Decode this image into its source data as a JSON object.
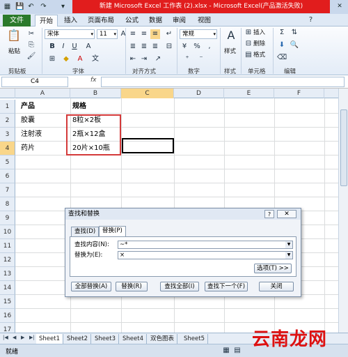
{
  "window": {
    "title": "新建 Microsoft Excel 工作表 (2).xlsx - Microsoft Excel(产品激活失败)",
    "controls": [
      "—",
      "□",
      "✕"
    ]
  },
  "ribbon": {
    "file_tab": "文件",
    "tabs": [
      "开始",
      "插入",
      "页面布局",
      "公式",
      "数据",
      "审阅",
      "视图"
    ],
    "groups": {
      "clipboard": {
        "label": "剪贴板",
        "paste": "粘贴"
      },
      "font": {
        "label": "字体",
        "font_name": "宋体",
        "font_size": "11"
      },
      "alignment": {
        "label": "对齐方式"
      },
      "number": {
        "label": "数字",
        "format": "常规"
      },
      "styles": {
        "label": "样式",
        "button": "样式"
      },
      "cells": {
        "label": "单元格",
        "insert": "插入",
        "delete": "删除",
        "format": "格式"
      },
      "editing": {
        "label": "编辑"
      }
    }
  },
  "formula_bar": {
    "name_box": "C4",
    "fx": "fx",
    "content": ""
  },
  "grid": {
    "columns": [
      "A",
      "B",
      "C",
      "D",
      "E",
      "F"
    ],
    "rows": [
      "1",
      "2",
      "3",
      "4",
      "5",
      "6",
      "7",
      "8",
      "9",
      "10",
      "11",
      "12",
      "13",
      "14",
      "15",
      "16",
      "17"
    ],
    "selected_column": "C",
    "selected_row": "4",
    "cells": {
      "A1": "产品",
      "B1": "规格",
      "A2": "胶囊",
      "B2": "8粒×2板",
      "A3": "注射液",
      "B3": "2瓶×12盒",
      "A4": "药片",
      "B4": "20片×10瓶"
    }
  },
  "sheets": [
    "Sheet1",
    "Sheet2",
    "Sheet3",
    "Sheet4",
    "双色图表",
    "Sheet5"
  ],
  "status": {
    "ready": "就绪"
  },
  "watermark": "云南龙网",
  "dialog": {
    "title": "查找和替换",
    "help": "?",
    "close": "✕",
    "tabs": [
      "查找(D)",
      "替换(P)"
    ],
    "find_label": "查找内容(N):",
    "find_value": "~*",
    "replace_label": "替换为(E):",
    "replace_value": "×",
    "options_button": "选项(T) >>",
    "buttons": [
      "全部替换(A)",
      "替换(R)",
      "查找全部(I)",
      "查找下一个(F)",
      "关闭"
    ]
  }
}
